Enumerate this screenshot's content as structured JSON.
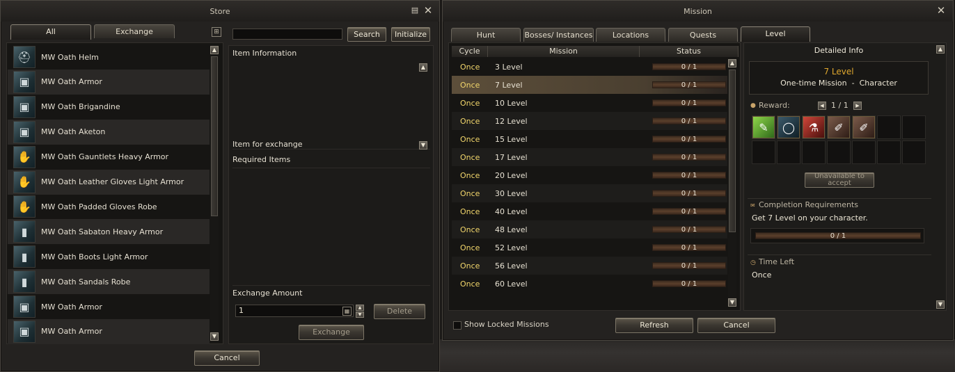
{
  "store": {
    "title": "Store",
    "tabs": [
      "All",
      "Exchange"
    ],
    "search_placeholder": "",
    "search_label": "Search",
    "initialize_label": "Initialize",
    "items": [
      "MW Oath Helm",
      "MW Oath Armor",
      "MW Oath Brigandine",
      "MW Oath Aketon",
      "MW Oath Gauntlets Heavy Armor",
      "MW Oath Leather Gloves Light Armor",
      "MW Oath Padded Gloves Robe",
      "MW Oath Sabaton Heavy Armor",
      "MW Oath Boots Light Armor",
      "MW Oath Sandals Robe",
      "MW Oath Armor",
      "MW Oath Armor"
    ],
    "item_information_label": "Item Information",
    "item_for_exchange_label": "Item for exchange",
    "required_items_label": "Required Items",
    "exchange_amount_label": "Exchange Amount",
    "exchange_amount_value": "1",
    "delete_label": "Delete",
    "exchange_label": "Exchange",
    "cancel_label": "Cancel"
  },
  "mission": {
    "title": "Mission",
    "tabs": [
      "Hunt",
      "Bosses/ Instances",
      "Locations",
      "Quests",
      "Level"
    ],
    "columns": [
      "Cycle",
      "Mission",
      "Status"
    ],
    "rows": [
      {
        "cycle": "Once",
        "name": "3 Level",
        "status": "0 / 1"
      },
      {
        "cycle": "Once",
        "name": "7 Level",
        "status": "0 / 1"
      },
      {
        "cycle": "Once",
        "name": "10 Level",
        "status": "0 / 1"
      },
      {
        "cycle": "Once",
        "name": "12 Level",
        "status": "0 / 1"
      },
      {
        "cycle": "Once",
        "name": "15 Level",
        "status": "0 / 1"
      },
      {
        "cycle": "Once",
        "name": "17 Level",
        "status": "0 / 1"
      },
      {
        "cycle": "Once",
        "name": "20 Level",
        "status": "0 / 1"
      },
      {
        "cycle": "Once",
        "name": "30 Level",
        "status": "0 / 1"
      },
      {
        "cycle": "Once",
        "name": "40 Level",
        "status": "0 / 1"
      },
      {
        "cycle": "Once",
        "name": "48 Level",
        "status": "0 / 1"
      },
      {
        "cycle": "Once",
        "name": "52 Level",
        "status": "0 / 1"
      },
      {
        "cycle": "Once",
        "name": "56 Level",
        "status": "0 / 1"
      },
      {
        "cycle": "Once",
        "name": "60 Level",
        "status": "0 / 1"
      }
    ],
    "detailed_info_label": "Detailed Info",
    "detail_title": "7 Level",
    "detail_subtitle": "One-time Mission  -  Character",
    "reward_label": "Reward:",
    "reward_page": "1 / 1",
    "unavailable_label": "Unavailable to accept",
    "completion_label": "Completion Requirements",
    "completion_text": "Get 7 Level on your character.",
    "completion_progress": "0 / 1",
    "time_left_label": "Time Left",
    "time_left_value": "Once",
    "show_locked_label": "Show Locked Missions",
    "refresh_label": "Refresh",
    "cancel_label": "Cancel"
  },
  "colors": {
    "accent_gold": "#f2d66b",
    "detail_title": "#e0a82e"
  }
}
